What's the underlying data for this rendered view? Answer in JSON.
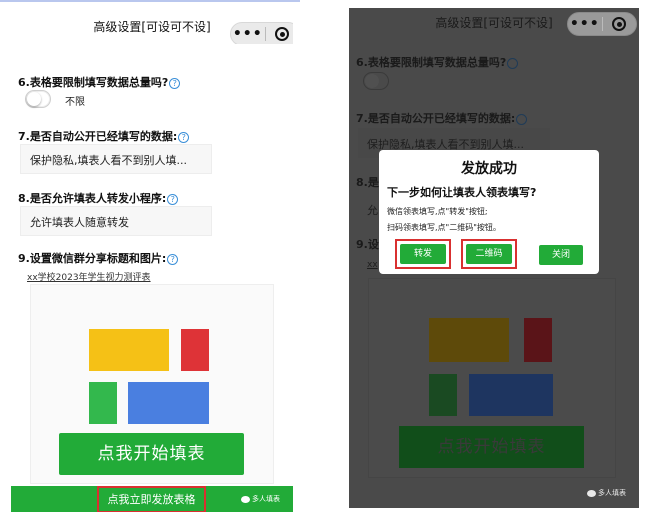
{
  "nav": {
    "title": "高级设置[可设可不设]",
    "more_glyph": "•••"
  },
  "form": {
    "q6": {
      "label": "6.表格要限制填写数据总量吗?",
      "toggle_label": "不限",
      "toggle_on": false
    },
    "q7": {
      "label": "7.是否自动公开已经填写的数据:",
      "value": "保护隐私,填表人看不到别人填..."
    },
    "q8": {
      "label": "8.是否允许填表人转发小程序:",
      "value": "允许填表人随意转发"
    },
    "q9": {
      "label": "9.设置微信群分享标题和图片:",
      "share_title": "xx学校2023年学生视力测评表"
    },
    "help_glyph": "?"
  },
  "preview": {
    "start_button": "点我开始填表",
    "colors": {
      "yellow": "#f5c116",
      "red": "#de3337",
      "green": "#33b84d",
      "blue": "#4a7fe0"
    }
  },
  "bottom": {
    "publish_button": "点我立即发放表格",
    "brand": "多人填表"
  },
  "dim": {
    "q6": "6.表格要限制填写数据总量吗?",
    "q7": "7.是否自动公开已经填写的数据:",
    "q7_value": "保护隐私,填表人看不到别人填...",
    "q8": "8.是",
    "q8_value": "允",
    "q9": "9.设",
    "share_stub": "xx",
    "start_button": "点我开始填表",
    "brand": "多人填表",
    "colors": {
      "yellow": "#5e4a0a",
      "red": "#5a1418",
      "green": "#1a4a22",
      "blue": "#1e3560"
    }
  },
  "modal": {
    "title": "发放成功",
    "subtitle": "下一步如何让填表人领表填写?",
    "line1": "微信领表填写,点\"转发\"按钮;",
    "line2": "扫码领表填写,点\"二维码\"按钮。",
    "forward_button": "转发",
    "qrcode_button": "二维码",
    "close_button": "关闭"
  },
  "theme": {
    "green": "#22ab38",
    "highlight": "#d93030"
  }
}
